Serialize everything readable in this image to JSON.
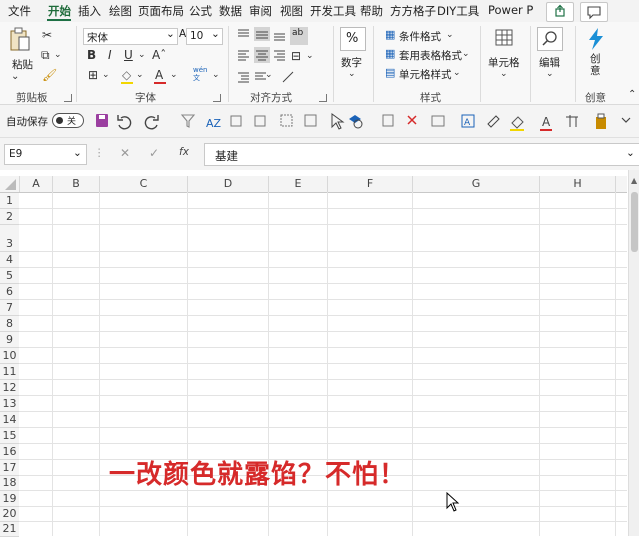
{
  "menu": {
    "items": [
      "文件",
      "开始",
      "插入",
      "绘图",
      "页面布局",
      "公式",
      "数据",
      "审阅",
      "视图",
      "开发工具",
      "帮助",
      "方方格子",
      "DIY工具",
      "Power P"
    ],
    "active": "开始"
  },
  "ribbon": {
    "clipboard": {
      "paste_label": "粘贴",
      "group_label": "剪贴板"
    },
    "font": {
      "font_name": "宋体",
      "font_size": "10",
      "group_label": "字体",
      "bold": "B",
      "italic": "I",
      "underline": "U",
      "font_color": "A",
      "phonetic": "wén\n文"
    },
    "alignment": {
      "group_label": "对齐方式",
      "wrap": "ab"
    },
    "number": {
      "label": "数字",
      "percent": "%"
    },
    "styles": {
      "conditional": "条件格式",
      "table": "套用表格格式",
      "cell": "单元格样式",
      "group_label": "样式"
    },
    "cells": {
      "label": "单元格"
    },
    "editing": {
      "label": "编辑"
    },
    "creative": {
      "label": "创\n意",
      "group_label": "创意"
    }
  },
  "qat": {
    "autosave_label": "自动保存",
    "toggle_label": "关"
  },
  "formula_bar": {
    "name_box": "E9",
    "fx": "fx",
    "content": "基建"
  },
  "columns": [
    "A",
    "B",
    "C",
    "D",
    "E",
    "F",
    "G",
    "H"
  ],
  "rows": [
    "1",
    "2",
    "3",
    "4",
    "5",
    "6",
    "7",
    "8",
    "9",
    "10",
    "11",
    "12",
    "13",
    "14",
    "15",
    "16",
    "17",
    "18",
    "19",
    "20",
    "21"
  ],
  "overlay_text": "一改颜色就露馅？不怕！",
  "colors": {
    "accent": "#1e7145",
    "overlay": "#d62a2a"
  }
}
